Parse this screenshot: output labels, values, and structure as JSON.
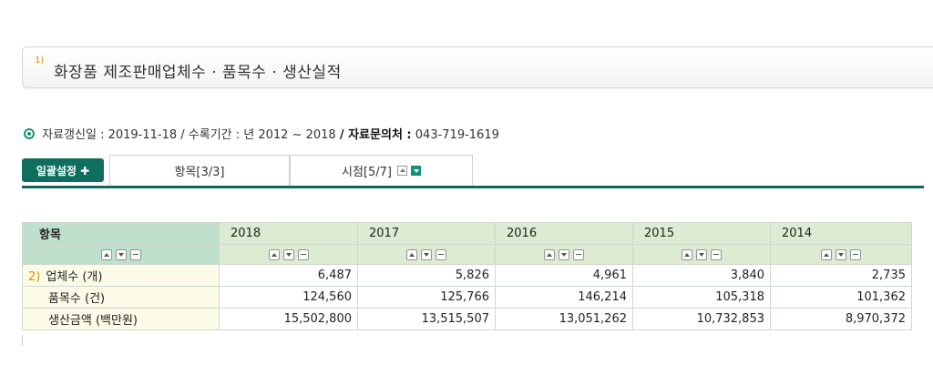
{
  "title": {
    "footnote": "1)",
    "text": "화장품 제조판매업체수 · 품목수 · 생산실적"
  },
  "meta": {
    "updated_label": "자료갱신일 : 2019-11-18 / 수록기간 : 년 2012 ~ 2018",
    "contact_label": "/ 자료문의처 :",
    "contact_phone": "043-719-1619"
  },
  "tabs": {
    "batch_label": "일괄설정 ✚",
    "item_tab": "항목[3/3]",
    "time_tab": "시점[5/7]"
  },
  "table": {
    "header_label": "항목",
    "years": [
      "2018",
      "2017",
      "2016",
      "2015",
      "2014"
    ],
    "rows": [
      {
        "footnote": "2)",
        "label": "업체수 (개)",
        "values": [
          "6,487",
          "5,826",
          "4,961",
          "3,840",
          "2,735"
        ]
      },
      {
        "footnote": "",
        "label": "품목수 (건)",
        "values": [
          "124,560",
          "125,766",
          "146,214",
          "105,318",
          "101,362"
        ]
      },
      {
        "footnote": "",
        "label": "생산금액 (백만원)",
        "values": [
          "15,502,800",
          "13,515,507",
          "13,051,262",
          "10,732,853",
          "8,970,372"
        ]
      }
    ]
  },
  "colors": {
    "accent": "#0f6f5f",
    "header_bg": "#dcebd2",
    "item_header_bg": "#bfe0cc",
    "label_bg": "#fbfbe8"
  }
}
